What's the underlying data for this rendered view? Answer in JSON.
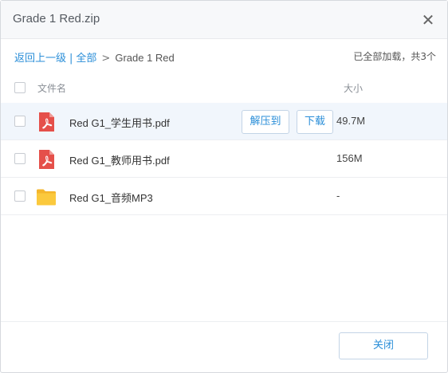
{
  "dialog": {
    "title": "Grade 1 Red.zip",
    "close_glyph": "✕"
  },
  "breadcrumb": {
    "back_label": "返回上一级",
    "separator": "|",
    "all_label": "全部",
    "arrow": ">",
    "current": "Grade 1 Red",
    "loaded_status": "已全部加载，共3个"
  },
  "table": {
    "col_name": "文件名",
    "col_size": "大小",
    "rows": [
      {
        "name": "Red G1_学生用书.pdf",
        "size": "49.7M",
        "type": "pdf-icon",
        "extract_label": "解压到",
        "download_label": "下载"
      },
      {
        "name": "Red G1_教师用书.pdf",
        "size": "156M",
        "type": "pdf-icon"
      },
      {
        "name": "Red G1_音频MP3",
        "size": "-",
        "type": "folder-icon"
      }
    ]
  },
  "footer": {
    "close_label": "关闭"
  },
  "colors": {
    "accent": "#2a8ed8",
    "pdf_red": "#e5504a",
    "folder_yellow": "#fbc93d",
    "hover_row": "#f1f6fc"
  }
}
